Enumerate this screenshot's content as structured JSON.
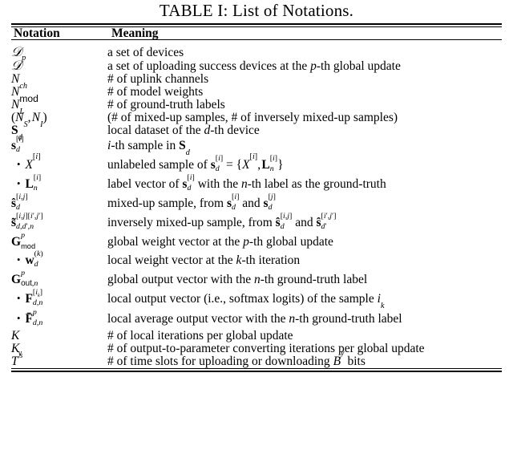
{
  "caption": "TABLE I: List of Notations.",
  "table": {
    "headers": {
      "notation": "Notation",
      "meaning": "Meaning"
    },
    "rows": [
      {
        "notation_text": "D",
        "meaning_text": "a set of devices"
      },
      {
        "notation_text": "D^p",
        "meaning_text": "a set of uploading success devices at the p-th global update"
      },
      {
        "notation_text": "N_ch",
        "meaning_text": "# of uplink channels"
      },
      {
        "notation_text": "N_mod",
        "meaning_text": "# of model weights"
      },
      {
        "notation_text": "N_L",
        "meaning_text": "# of ground-truth labels"
      },
      {
        "notation_text": "(N_S, N_I)",
        "meaning_text": "(# of mixed-up samples, # of inversely mixed-up samples)"
      },
      {
        "notation_text": "S_d",
        "meaning_text": "local dataset of the d-th device"
      },
      {
        "notation_text": "s_d^[i]",
        "meaning_text": "i-th sample in S_d"
      },
      {
        "notation_text": "• X^[i]",
        "meaning_text": "unlabeled sample of s_d^[i] = {X^[i], L_n^[i]}"
      },
      {
        "notation_text": "• L_n^[i]",
        "meaning_text": "label vector of s_d^[i] with the n-th label as the ground-truth"
      },
      {
        "notation_text": "ŝ_d^[i,j]",
        "meaning_text": "mixed-up sample, from s_d^[i] and s_d^[j]"
      },
      {
        "notation_text": "s̃_{d,d',n}^{[i,j][i',j']}",
        "meaning_text": "inversely mixed-up sample, from ŝ_d^[i,j] and ŝ_d'^[i',j']"
      },
      {
        "notation_text": "G_mod^p",
        "meaning_text": "global weight vector at the p-th global update"
      },
      {
        "notation_text": "• w_d^(k)",
        "meaning_text": "local weight vector at the k-th iteration"
      },
      {
        "notation_text": "G_{out,n}^p",
        "meaning_text": "global output vector with the n-th ground-truth label"
      },
      {
        "notation_text": "• F_{d,n}^{[i_k]}",
        "meaning_text": "local output vector (i.e., softmax logits) of the sample i_k"
      },
      {
        "notation_text": "• F̄_{d,n}^p",
        "meaning_text": "local average output vector with the n-th ground-truth label"
      },
      {
        "notation_text": "K",
        "meaning_text": "# of local iterations per global update"
      },
      {
        "notation_text": "K_s",
        "meaning_text": "# of output-to-parameter converting iterations per global update"
      },
      {
        "notation_text": "T^y",
        "meaning_text": "# of time slots for uploading or downloading B^y bits"
      }
    ]
  },
  "colors": {
    "text": "#000000",
    "background": "#ffffff",
    "rule": "#000000"
  }
}
